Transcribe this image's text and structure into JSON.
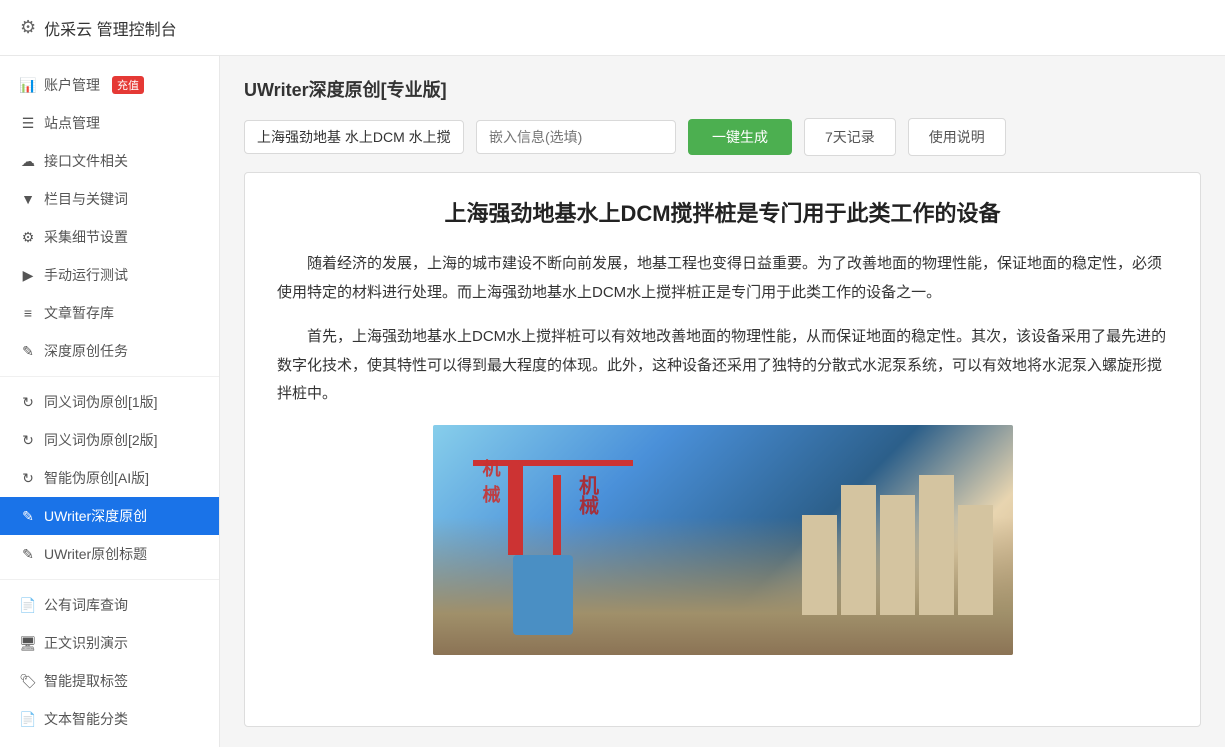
{
  "header": {
    "title": "优采云 管理控制台",
    "gear_label": "⚙"
  },
  "sidebar": {
    "sections": [
      {
        "items": [
          {
            "id": "account",
            "icon": "📊",
            "label": "账户管理",
            "badge": "充值",
            "active": false
          },
          {
            "id": "site",
            "icon": "☰",
            "label": "站点管理",
            "active": false
          },
          {
            "id": "interface",
            "icon": "☁",
            "label": "接口文件相关",
            "active": false
          },
          {
            "id": "column",
            "icon": "▼",
            "label": "栏目与关键词",
            "active": false
          },
          {
            "id": "collect",
            "icon": "⚙",
            "label": "采集细节设置",
            "active": false
          },
          {
            "id": "manual",
            "icon": "▶",
            "label": "手动运行测试",
            "active": false
          },
          {
            "id": "draft",
            "icon": "≡",
            "label": "文章暂存库",
            "active": false
          },
          {
            "id": "original",
            "icon": "✎",
            "label": "深度原创任务",
            "active": false
          }
        ]
      },
      {
        "items": [
          {
            "id": "synonym1",
            "icon": "↻",
            "label": "同义词伪原创[1版]",
            "active": false
          },
          {
            "id": "synonym2",
            "icon": "↻",
            "label": "同义词伪原创[2版]",
            "active": false
          },
          {
            "id": "ai",
            "icon": "↻",
            "label": "智能伪原创[AI版]",
            "active": false
          },
          {
            "id": "uwriter",
            "icon": "✎",
            "label": "UWriter深度原创",
            "active": true
          },
          {
            "id": "title",
            "icon": "✎",
            "label": "UWriter原创标题",
            "active": false
          }
        ]
      },
      {
        "items": [
          {
            "id": "company",
            "icon": "📄",
            "label": "公有词库查询",
            "active": false
          },
          {
            "id": "recognition",
            "icon": "🖥",
            "label": "正文识别演示",
            "active": false
          },
          {
            "id": "tags",
            "icon": "🏷",
            "label": "智能提取标签",
            "active": false
          },
          {
            "id": "classify",
            "icon": "📄",
            "label": "文本智能分类",
            "active": false
          }
        ]
      }
    ]
  },
  "main": {
    "title": "UWriter深度原创[专业版]",
    "keywords_placeholder": "上海强劲地基 水上DCM 水上搅",
    "embed_placeholder": "嵌入信息(选填)",
    "btn_generate": "一键生成",
    "btn_history": "7天记录",
    "btn_help": "使用说明",
    "article": {
      "title": "上海强劲地基水上DCM搅拌桩是专门用于此类工作的设备",
      "paragraphs": [
        "随着经济的发展，上海的城市建设不断向前发展，地基工程也变得日益重要。为了改善地面的物理性能，保证地面的稳定性，必须使用特定的材料进行处理。而上海强劲地基水上DCM水上搅拌桩正是专门用于此类工作的设备之一。",
        "首先，上海强劲地基水上DCM水上搅拌桩可以有效地改善地面的物理性能，从而保证地面的稳定性。其次，该设备采用了最先进的数字化技术，使其特性可以得到最大程度的体现。此外，这种设备还采用了独特的分散式水泥泵系统，可以有效地将水泥泵入螺旋形搅拌桩中。"
      ]
    }
  }
}
